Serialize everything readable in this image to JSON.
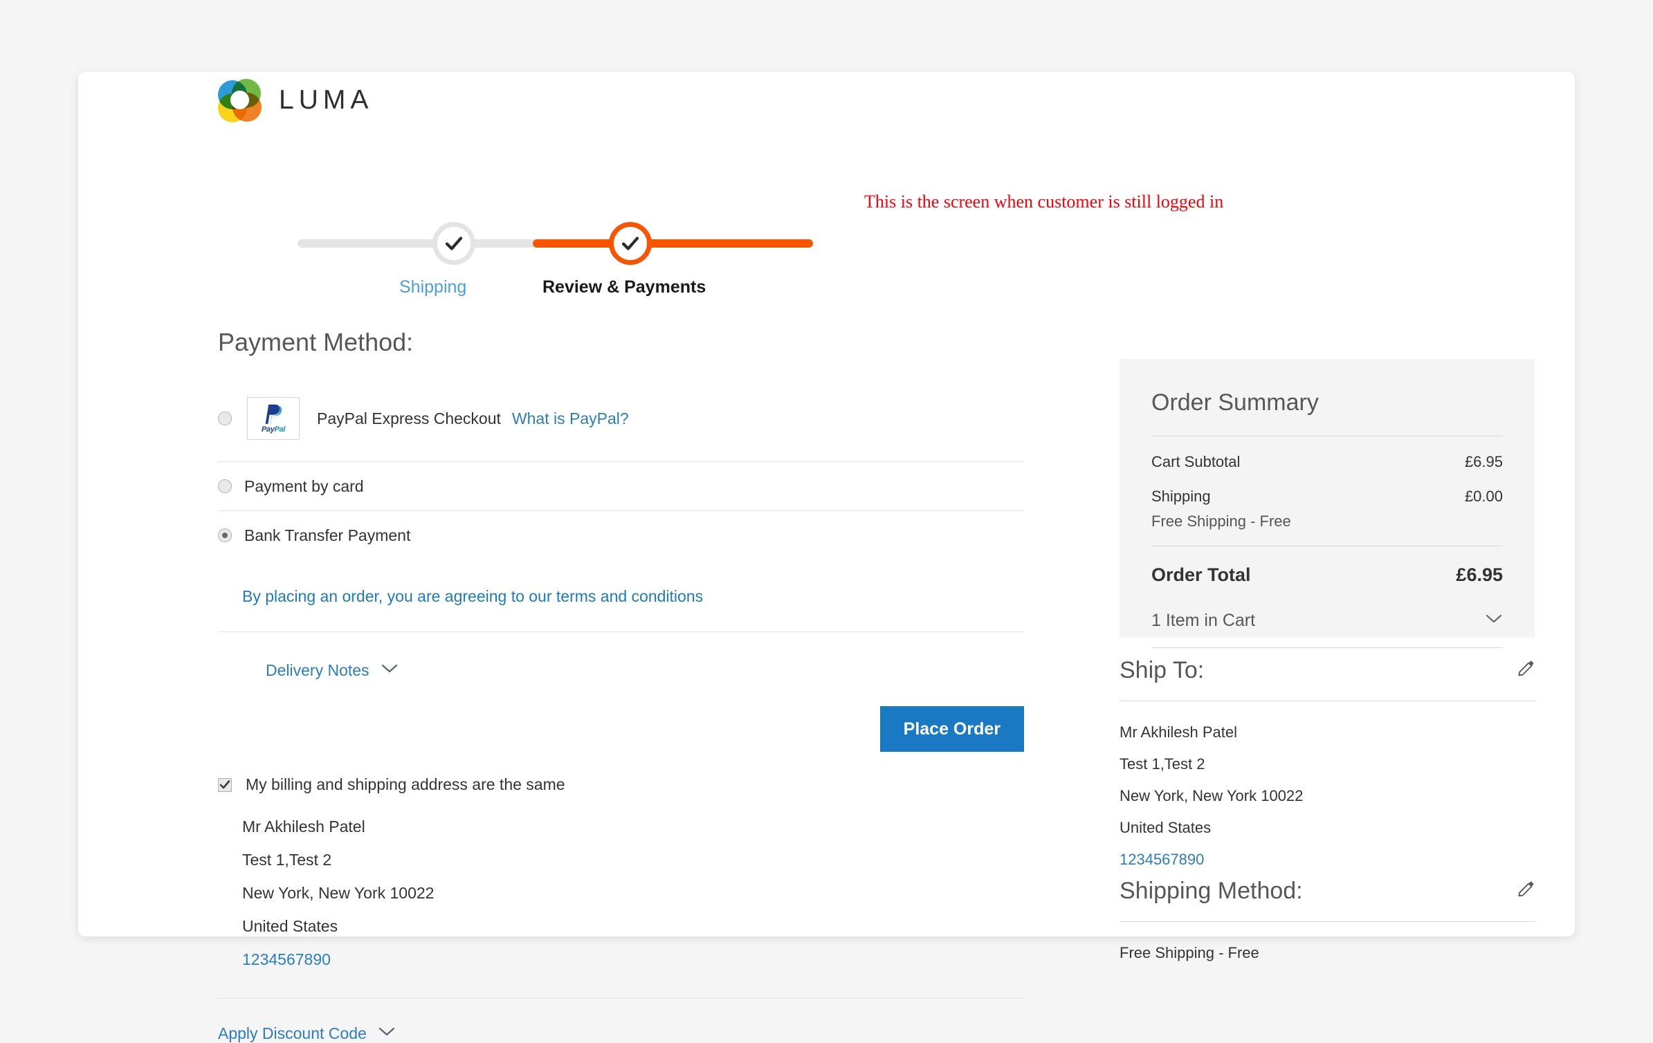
{
  "brand": {
    "name": "LUMA"
  },
  "annotation": {
    "text": "This is the screen when customer is still logged in"
  },
  "progress": {
    "steps": [
      {
        "label": "Shipping",
        "state": "done"
      },
      {
        "label": "Review & Payments",
        "state": "active"
      }
    ]
  },
  "payment": {
    "heading": "Payment Method:",
    "methods": [
      {
        "label": "PayPal Express Checkout",
        "help_link": "What is PayPal?",
        "logo": "paypal-logo",
        "selected": false
      },
      {
        "label": "Payment by card",
        "selected": false
      },
      {
        "label": "Bank Transfer Payment",
        "selected": true
      }
    ],
    "terms_link": "By placing an order, you are agreeing to our terms and conditions",
    "delivery_notes_label": "Delivery Notes",
    "place_order_label": "Place Order"
  },
  "billing": {
    "same_address_label": "My billing and shipping address are the same",
    "same_address_checked": true,
    "address": [
      "Mr Akhilesh Patel",
      "Test 1,Test 2",
      "New York, New York 10022",
      "United States"
    ],
    "phone": "1234567890"
  },
  "discount": {
    "label": "Apply Discount Code"
  },
  "order_summary": {
    "title": "Order Summary",
    "rows": [
      {
        "key": "Cart Subtotal",
        "value": "£6.95"
      },
      {
        "key": "Shipping",
        "value": "£0.00",
        "sub": "Free Shipping - Free"
      }
    ],
    "total_key": "Order Total",
    "total_value": "£6.95",
    "cart_items_label": "1 Item in Cart"
  },
  "ship_to": {
    "title": "Ship To:",
    "edit_icon": "pencil-icon",
    "address": [
      "Mr Akhilesh Patel",
      "Test 1,Test 2",
      "New York, New York 10022",
      "United States"
    ],
    "phone": "1234567890"
  },
  "shipping_method": {
    "title": "Shipping Method:",
    "edit_icon": "pencil-icon",
    "value": "Free Shipping - Free"
  },
  "colors": {
    "accent_orange": "#fa5400",
    "link_blue": "#2a7ec0",
    "button_blue": "#1979c3",
    "annotation_red": "#fb0007"
  }
}
